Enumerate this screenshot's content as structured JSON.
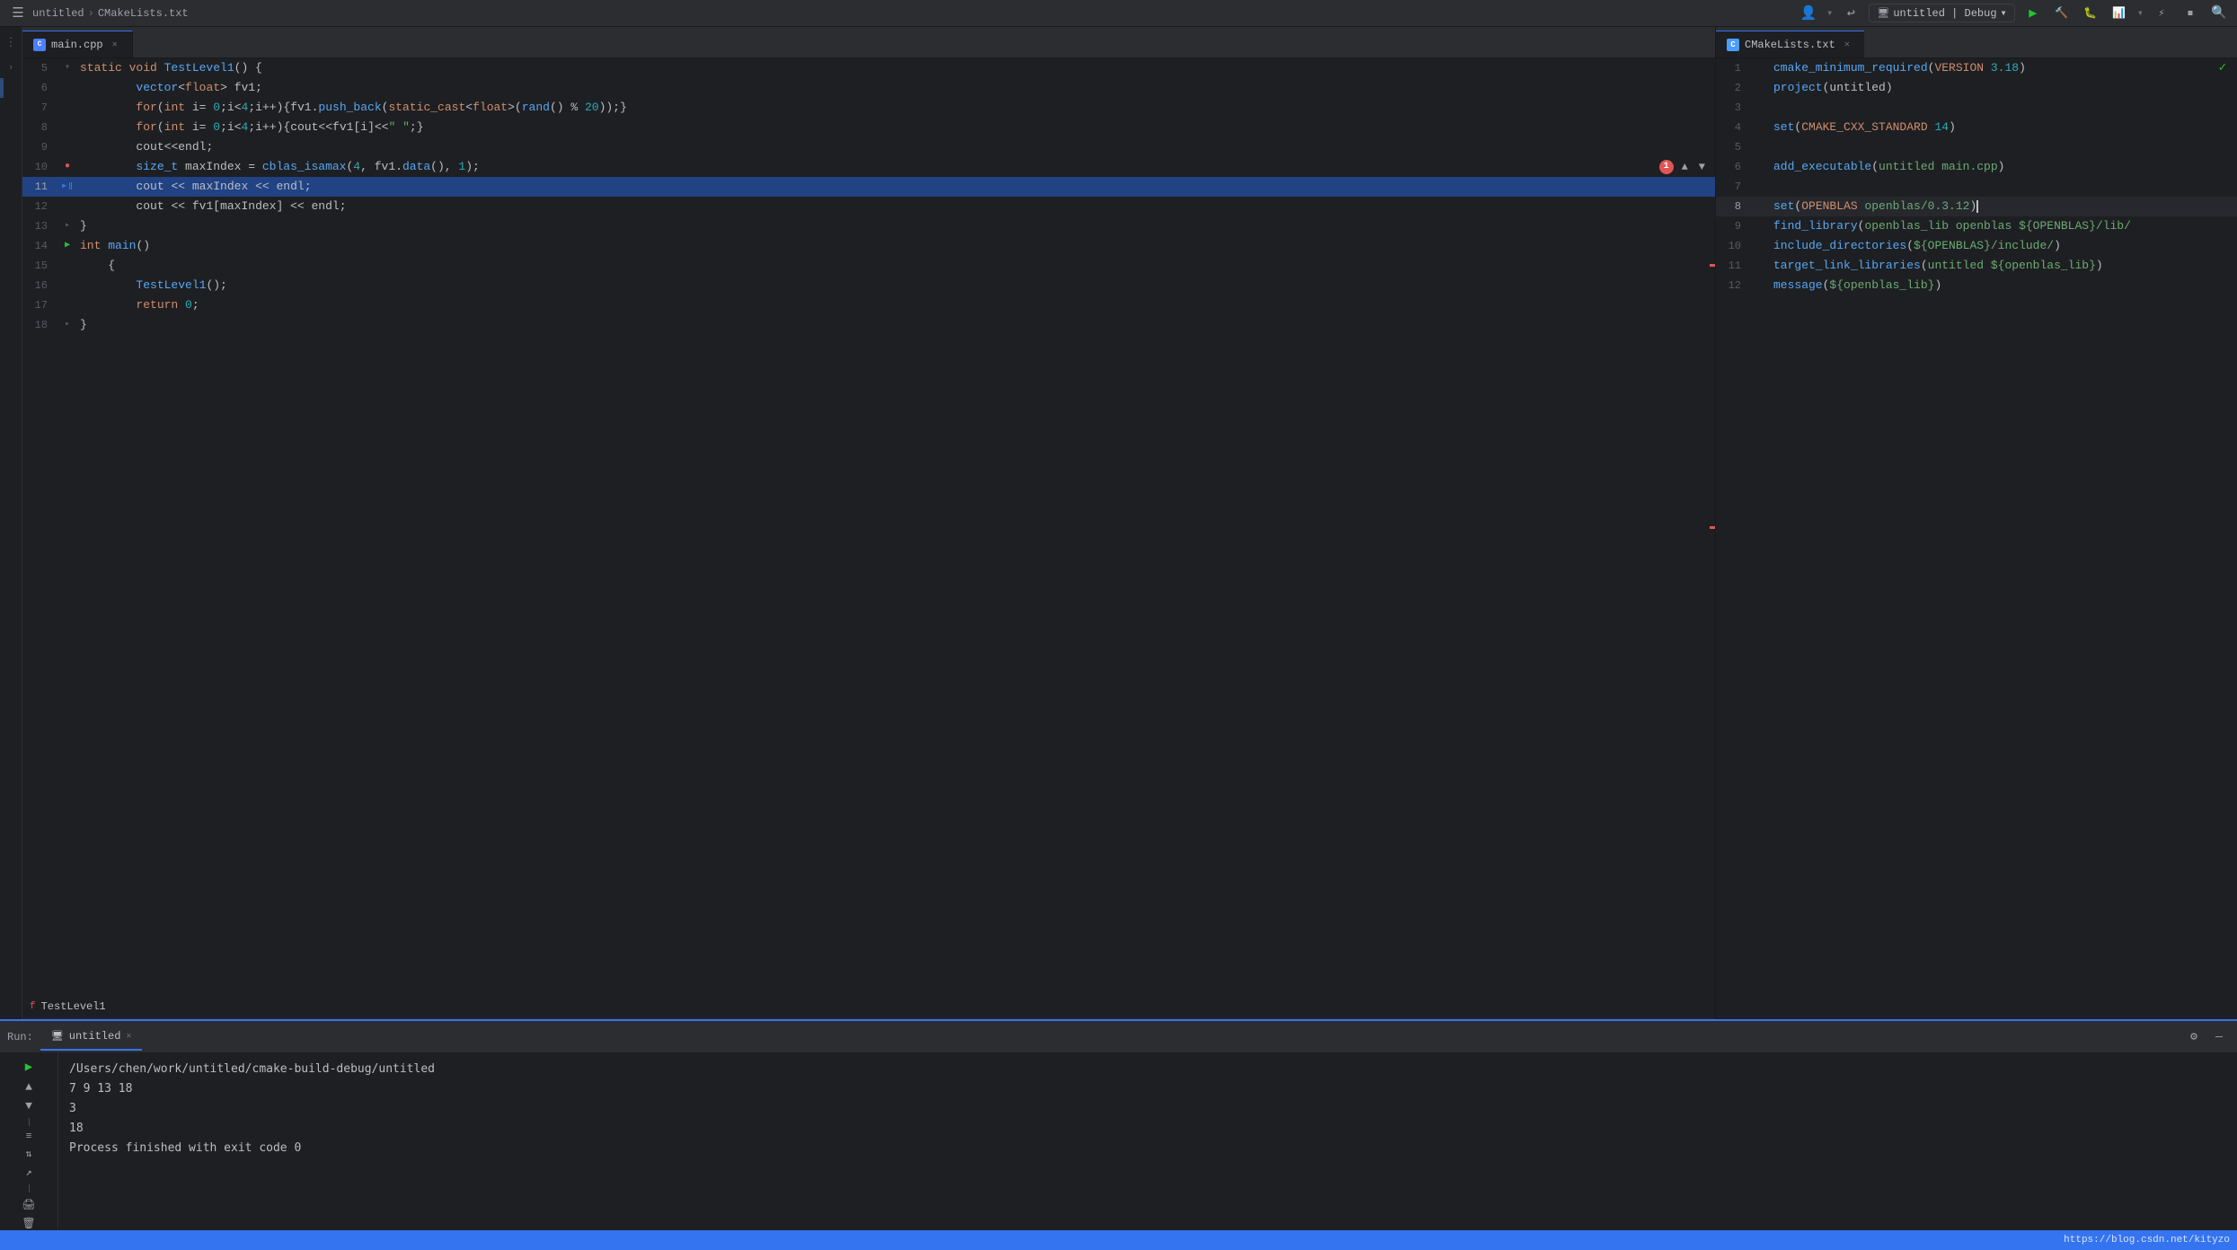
{
  "topbar": {
    "breadcrumb1": "untitled",
    "breadcrumb2": "CMakeLists.txt",
    "runconfig": "untitled | Debug",
    "chevron": "▾"
  },
  "leftEditor": {
    "tab": "main.cpp",
    "lines": [
      {
        "num": "5",
        "indent": 1,
        "tokens": [
          {
            "t": "kw",
            "v": "static "
          },
          {
            "t": "kw",
            "v": "void "
          },
          {
            "t": "fn",
            "v": "TestLevel1"
          },
          {
            "t": "punc",
            "v": "() {"
          }
        ]
      },
      {
        "num": "6",
        "indent": 2,
        "tokens": [
          {
            "t": "type",
            "v": "vector"
          },
          {
            "t": "punc",
            "v": "<"
          },
          {
            "t": "kw",
            "v": "float"
          },
          {
            "t": "punc",
            "v": "> "
          },
          {
            "t": "var",
            "v": "fv1"
          },
          {
            "t": "punc",
            "v": ";"
          }
        ]
      },
      {
        "num": "7",
        "indent": 2,
        "tokens": [
          {
            "t": "kw",
            "v": "for"
          },
          {
            "t": "punc",
            "v": "("
          },
          {
            "t": "kw",
            "v": "int "
          },
          {
            "t": "var",
            "v": "i"
          },
          {
            "t": "op",
            "v": "= "
          },
          {
            "t": "num",
            "v": "0"
          },
          {
            "t": "punc",
            "v": ";"
          },
          {
            "t": "var",
            "v": "i"
          },
          {
            "t": "op",
            "v": "<"
          },
          {
            "t": "num",
            "v": "4"
          },
          {
            "t": "punc",
            "v": ";"
          },
          {
            "t": "var",
            "v": "i"
          },
          {
            "t": "op",
            "v": "++"
          },
          {
            "t": "punc",
            "v": "){"
          },
          {
            "t": "var",
            "v": "fv1"
          },
          {
            "t": "punc",
            "v": "."
          },
          {
            "t": "fn",
            "v": "push_back"
          },
          {
            "t": "punc",
            "v": "("
          },
          {
            "t": "kw",
            "v": "static_cast"
          },
          {
            "t": "punc",
            "v": "<"
          },
          {
            "t": "kw",
            "v": "float"
          },
          {
            "t": "punc",
            "v": ">("
          },
          {
            "t": "fn",
            "v": "rand"
          },
          {
            "t": "punc",
            "v": "() % "
          },
          {
            "t": "num",
            "v": "20"
          },
          {
            "t": "punc",
            "v": "));};"
          }
        ]
      },
      {
        "num": "8",
        "indent": 2,
        "tokens": [
          {
            "t": "kw",
            "v": "for"
          },
          {
            "t": "punc",
            "v": "("
          },
          {
            "t": "kw",
            "v": "int "
          },
          {
            "t": "var",
            "v": "i"
          },
          {
            "t": "op",
            "v": "= "
          },
          {
            "t": "num",
            "v": "0"
          },
          {
            "t": "punc",
            "v": ";"
          },
          {
            "t": "var",
            "v": "i"
          },
          {
            "t": "op",
            "v": "<"
          },
          {
            "t": "num",
            "v": "4"
          },
          {
            "t": "punc",
            "v": ";"
          },
          {
            "t": "var",
            "v": "i"
          },
          {
            "t": "op",
            "v": "++"
          },
          {
            "t": "punc",
            "v": "){"
          },
          {
            "t": "var",
            "v": "cout"
          },
          {
            "t": "op",
            "v": "<<"
          },
          {
            "t": "var",
            "v": "fv1"
          },
          {
            "t": "punc",
            "v": "["
          },
          {
            "t": "var",
            "v": "i"
          },
          {
            "t": "punc",
            "v": "]"
          },
          {
            "t": "op",
            "v": "<<"
          },
          {
            "t": "str",
            "v": "\" \""
          },
          {
            "t": "punc",
            "v": ";}"
          }
        ]
      },
      {
        "num": "9",
        "indent": 2,
        "tokens": [
          {
            "t": "var",
            "v": "cout"
          },
          {
            "t": "op",
            "v": "<<"
          },
          {
            "t": "var",
            "v": "endl"
          },
          {
            "t": "punc",
            "v": ";"
          }
        ]
      },
      {
        "num": "10",
        "indent": 2,
        "hasError": true,
        "tokens": [
          {
            "t": "type",
            "v": "size_t "
          },
          {
            "t": "var",
            "v": "maxIndex "
          },
          {
            "t": "op",
            "v": "= "
          },
          {
            "t": "fn",
            "v": "cblas_isamax"
          },
          {
            "t": "punc",
            "v": "("
          },
          {
            "t": "num",
            "v": "4"
          },
          {
            "t": "punc",
            "v": ", "
          },
          {
            "t": "var",
            "v": "fv1"
          },
          {
            "t": "punc",
            "v": "."
          },
          {
            "t": "fn",
            "v": "data"
          },
          {
            "t": "punc",
            "v": "(), "
          },
          {
            "t": "num",
            "v": "1"
          },
          {
            "t": "punc",
            "v": ");"
          }
        ]
      },
      {
        "num": "11",
        "indent": 2,
        "hasCurrent": true,
        "tokens": [
          {
            "t": "var",
            "v": "cout "
          },
          {
            "t": "op",
            "v": "<< "
          },
          {
            "t": "var",
            "v": "maxIndex "
          },
          {
            "t": "op",
            "v": "<< "
          },
          {
            "t": "var",
            "v": "endl"
          },
          {
            "t": "punc",
            "v": ";"
          }
        ]
      },
      {
        "num": "12",
        "indent": 2,
        "tokens": [
          {
            "t": "var",
            "v": "cout "
          },
          {
            "t": "op",
            "v": "<< "
          },
          {
            "t": "var",
            "v": "fv1"
          },
          {
            "t": "punc",
            "v": "["
          },
          {
            "t": "var",
            "v": "maxIndex"
          },
          {
            "t": "punc",
            "v": "] "
          },
          {
            "t": "op",
            "v": "<< "
          },
          {
            "t": "var",
            "v": "endl"
          },
          {
            "t": "punc",
            "v": ";"
          }
        ]
      },
      {
        "num": "13",
        "indent": 1,
        "tokens": [
          {
            "t": "punc",
            "v": "}"
          }
        ]
      },
      {
        "num": "14",
        "indent": 0,
        "hasRun": true,
        "tokens": [
          {
            "t": "kw",
            "v": "int "
          },
          {
            "t": "fn",
            "v": "main"
          },
          {
            "t": "punc",
            "v": "()"
          }
        ]
      },
      {
        "num": "15",
        "indent": 1,
        "tokens": [
          {
            "t": "punc",
            "v": "{"
          }
        ]
      },
      {
        "num": "16",
        "indent": 2,
        "tokens": [
          {
            "t": "fn",
            "v": "TestLevel1"
          },
          {
            "t": "punc",
            "v": "();"
          }
        ]
      },
      {
        "num": "17",
        "indent": 2,
        "tokens": [
          {
            "t": "kw",
            "v": "return "
          },
          {
            "t": "num",
            "v": "0"
          },
          {
            "t": "punc",
            "v": ";"
          }
        ]
      },
      {
        "num": "18",
        "indent": 1,
        "tokens": [
          {
            "t": "punc",
            "v": "}"
          }
        ]
      }
    ]
  },
  "cmakeEditor": {
    "tab": "CMakeLists.txt",
    "lines": [
      {
        "num": "1",
        "code": "cmake_minimum_required(VERSION 3.18)",
        "hasCheck": true
      },
      {
        "num": "2",
        "code": "project(untitled)"
      },
      {
        "num": "3",
        "code": ""
      },
      {
        "num": "4",
        "code": "set(CMAKE_CXX_STANDARD 14)"
      },
      {
        "num": "5",
        "code": ""
      },
      {
        "num": "6",
        "code": "add_executable(untitled main.cpp)"
      },
      {
        "num": "7",
        "code": ""
      },
      {
        "num": "8",
        "code": "set(OPENBLAS openblas/0.3.12)",
        "isCurrent": true
      },
      {
        "num": "9",
        "code": "find_library(openblas_lib openblas ${OPENBLAS}/lib/"
      },
      {
        "num": "10",
        "code": "include_directories(${OPENBLAS}/include/)"
      },
      {
        "num": "11",
        "code": "target_link_libraries(untitled ${openblas_lib})"
      },
      {
        "num": "12",
        "code": "message(${openblas_lib})"
      }
    ]
  },
  "bottomPanel": {
    "tab": "untitled",
    "runPath": "/Users/chen/work/untitled/cmake-build-debug/untitled",
    "output1": "7 9 13 18",
    "output2": "3",
    "output3": "18",
    "output4": "",
    "output5": "Process finished with exit code 0",
    "breadcrumbLabel": "TestLevel1"
  },
  "statusBar": {
    "rightText": "https://blog.csdn.net/kityzo"
  }
}
